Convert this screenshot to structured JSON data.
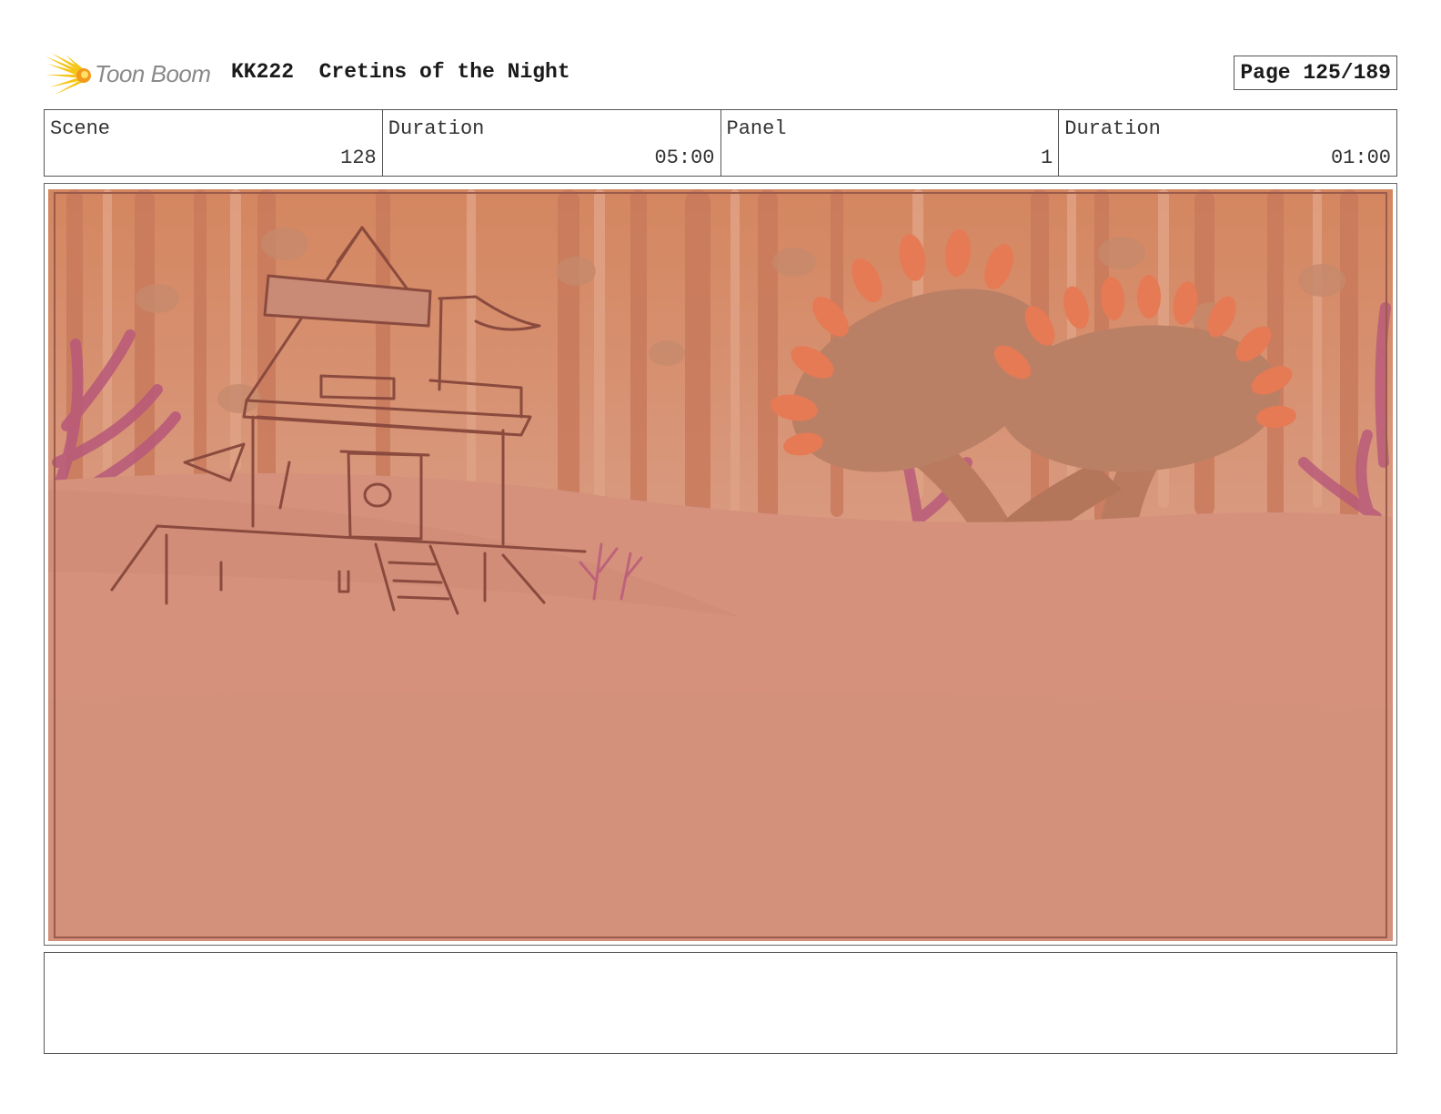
{
  "header": {
    "logo_text": "Toon Boom",
    "title": "KK222  Cretins of the Night",
    "page": "Page 125/189"
  },
  "info": [
    {
      "label": "Scene",
      "value": "128"
    },
    {
      "label": "Duration",
      "value": "05:00"
    },
    {
      "label": "Panel",
      "value": "1"
    },
    {
      "label": "Duration",
      "value": "01:00"
    }
  ],
  "colors": {
    "panel_tint": "#d5917c",
    "sketch_line": "#8a4a3e",
    "fungus_orange": "#e57a55",
    "coral_pink": "#b8587a"
  },
  "icons": {
    "logo": "toon-boom-starburst-icon"
  },
  "notes": ""
}
